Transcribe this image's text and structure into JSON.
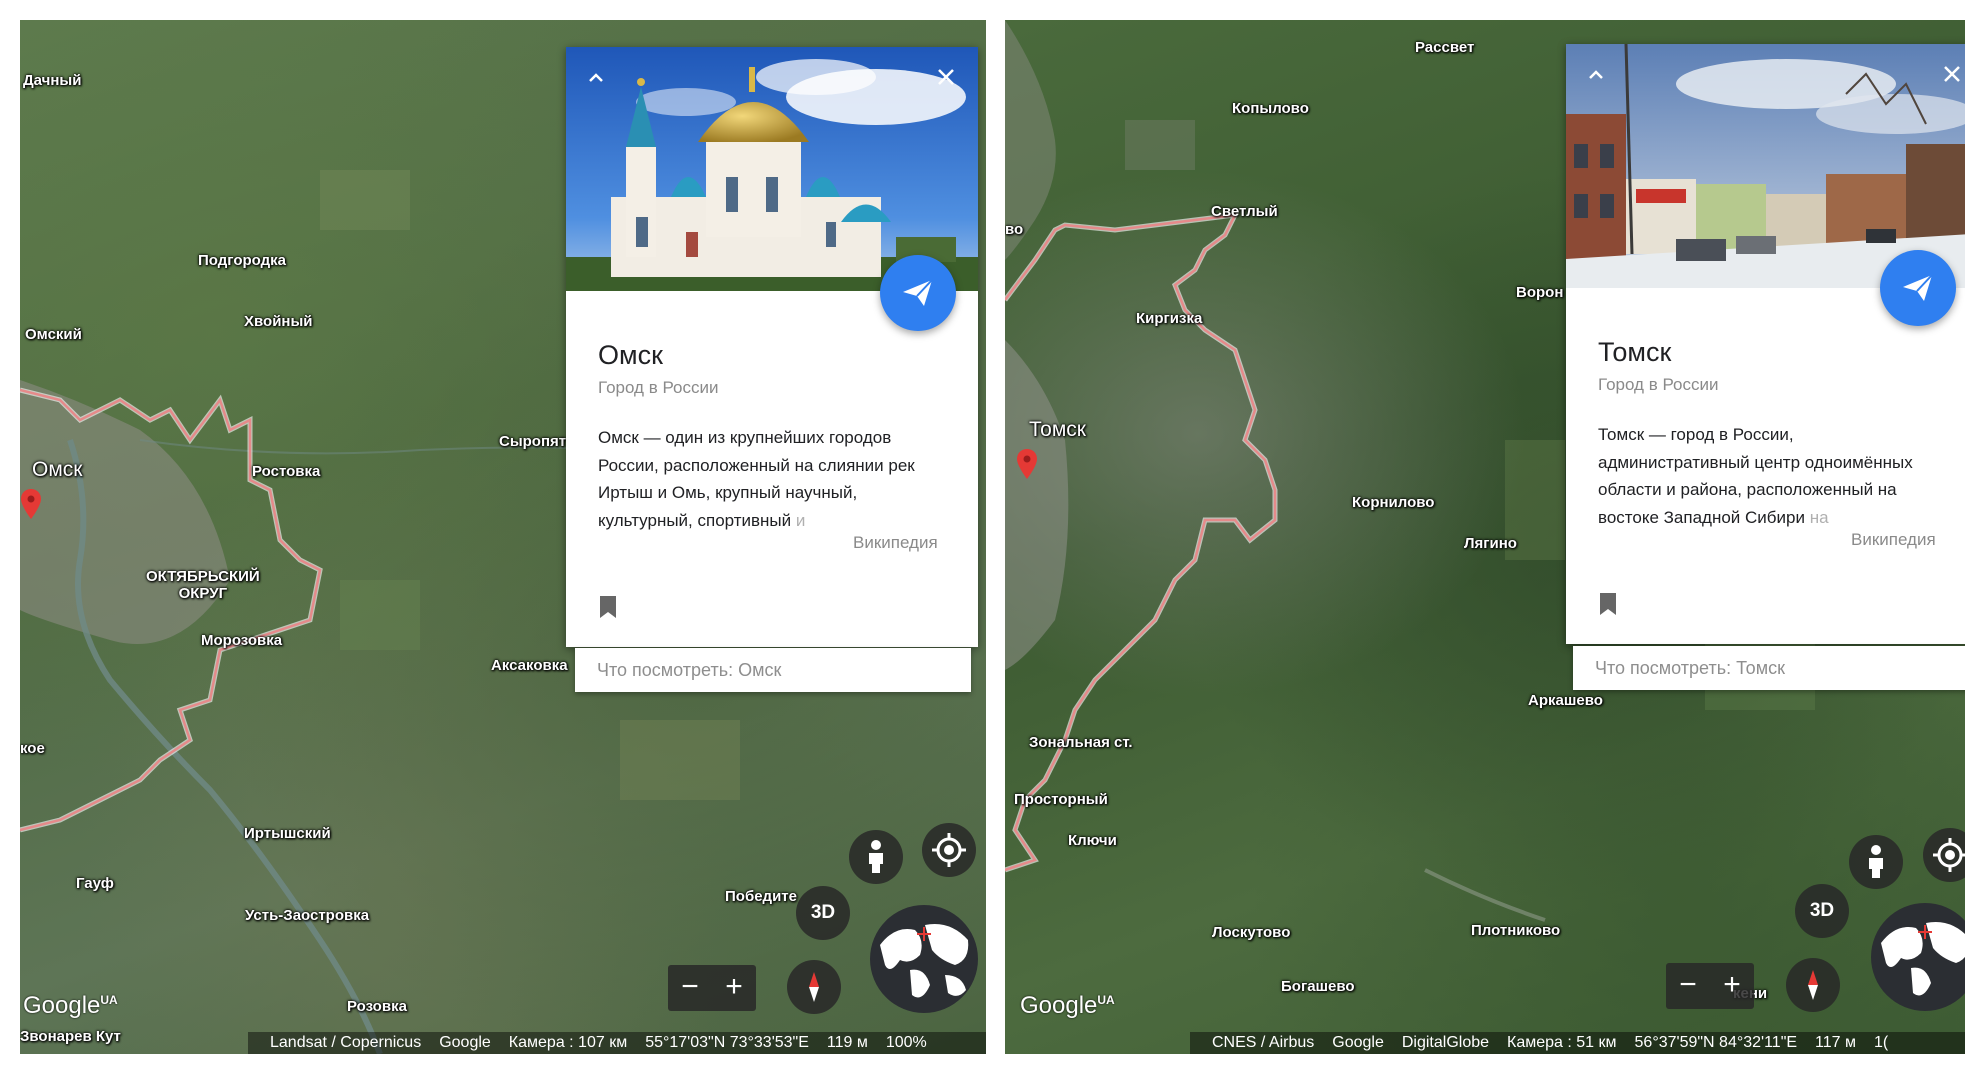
{
  "left": {
    "places": {
      "dachny": "Дачный",
      "podgorodka": "Подгородка",
      "khvoyny": "Хвойный",
      "omsky": "Омский",
      "omsk": "Омск",
      "rostovka": "Ростовка",
      "syropyat": "Сыропят",
      "oktyabrsky_line1": "ОКТЯБРЬСКИЙ",
      "oktyabrsky_line2": "ОКРУГ",
      "morozovka": "Морозовка",
      "aksakovka": "Аксаковка",
      "koe": "кое",
      "irtyshsky": "Иртышский",
      "gauf": "Гауф",
      "pobedite": "Победите",
      "ust_zaostrovka": "Усть-Заостровка",
      "rozovka": "Розовка",
      "zvonarev_kut": "Звонарев Кут"
    },
    "card": {
      "collapse_icon": "chevron-up-icon",
      "close_icon": "close-icon",
      "share_icon": "paper-plane-icon",
      "title": "Омск",
      "subtitle": "Город в России",
      "desc_line1": "Омск — один из крупнейших городов",
      "desc_line2": "России, расположенный на слиянии рек",
      "desc_line3": "Иртыш и Омь, крупный научный,",
      "desc_line4": "культурный, спортивный",
      "desc_fade": "и",
      "wiki": "Википедия",
      "bookmark_icon": "bookmark-icon"
    },
    "see_more": "Что посмотреть: Омск",
    "controls": {
      "btn_3d": "3D",
      "zoom_out": "−",
      "zoom_in": "+"
    },
    "logo": "Google",
    "logo_sup": "UA",
    "attribution": {
      "sources": "Landsat / Copernicus",
      "brand": "Google",
      "camera": "Камера :  107 км",
      "coords": "55°17'03\"N 73°33'53\"E",
      "altitude": "119 м",
      "percent": "100%"
    }
  },
  "right": {
    "places": {
      "rassvet": "Рассвет",
      "kopylovo": "Копылово",
      "svetly": "Светлый",
      "vo": "во",
      "kirgizka": "Киргизка",
      "voron": "Ворон",
      "tomsk": "Томск",
      "kornilovo": "Корнилово",
      "lyagino": "Лягино",
      "arkashevo": "Аркашево",
      "zonalnaya": "Зональная ст.",
      "prostorny": "Просторный",
      "klyuchi": "Ключи",
      "loskutovo": "Лоскутово",
      "plotnikovo": "Плотниково",
      "bogashevo": "Богашево",
      "keni": "кени"
    },
    "card": {
      "collapse_icon": "chevron-up-icon",
      "close_icon": "close-icon",
      "share_icon": "paper-plane-icon",
      "title": "Томск",
      "subtitle": "Город в России",
      "desc_line1": "Томск — город в России,",
      "desc_line2": "административный центр одноимённых",
      "desc_line3": "области и района, расположенный на",
      "desc_line4": "востоке Западной Сибири",
      "desc_fade": "на",
      "wiki": "Википедия",
      "bookmark_icon": "bookmark-icon"
    },
    "see_more": "Что посмотреть: Томск",
    "controls": {
      "btn_3d": "3D",
      "zoom_out": "−",
      "zoom_in": "+"
    },
    "logo": "Google",
    "logo_sup": "UA",
    "attribution": {
      "sources": "CNES / Airbus",
      "brand": "Google",
      "sources2": "DigitalGlobe",
      "camera": "Камера :  51 км",
      "coords": "56°37'59\"N 84°32'11\"E",
      "altitude": "117 м",
      "percent": "1("
    }
  },
  "colors": {
    "accent_blue": "#2f7ff0",
    "boundary": "#e58a8a",
    "pin": "#e53935",
    "river": "#6f8a86"
  }
}
